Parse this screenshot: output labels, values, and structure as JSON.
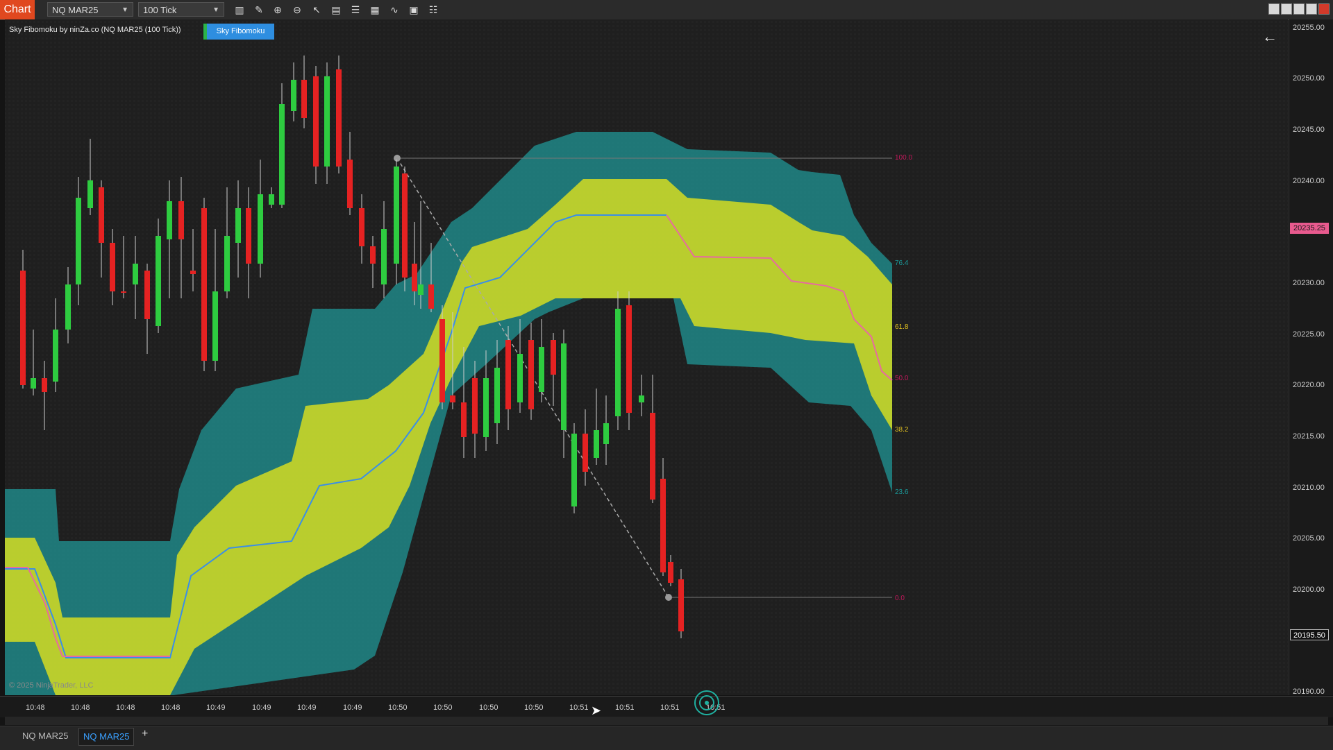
{
  "toolbar": {
    "chart_button": "Chart",
    "instrument": "NQ MAR25",
    "interval": "100 Tick",
    "icons": [
      "bars-icon",
      "draw-pencil-icon",
      "zoom-in-icon",
      "zoom-out-icon",
      "pointer-icon",
      "data-box-icon",
      "properties-icon",
      "strategy-icon",
      "indicators-icon",
      "list-icon"
    ]
  },
  "indicator": {
    "label": "Sky Fibomoku by ninZa.co (NQ MAR25 (100 Tick))",
    "button": "Sky Fibomoku"
  },
  "copyright": "© 2025 NinjaTrader, LLC",
  "price_axis": {
    "ticks": [
      "20255.00",
      "20250.00",
      "20245.00",
      "20240.00",
      "20235.00",
      "20230.00",
      "20225.00",
      "20220.00",
      "20215.00",
      "20210.00",
      "20205.00",
      "20200.00",
      "20195.00",
      "20190.00"
    ],
    "current_price": "20235.25",
    "last_price": "20195.50",
    "current_color": "#e85a8e"
  },
  "time_axis": {
    "ticks": [
      "10:48",
      "10:48",
      "10:48",
      "10:48",
      "10:49",
      "10:49",
      "10:49",
      "10:49",
      "10:50",
      "10:50",
      "10:50",
      "10:50",
      "10:51",
      "10:51",
      "10:51",
      "10:51"
    ]
  },
  "fib_levels": [
    {
      "label": "100.0",
      "color": "#c2185b"
    },
    {
      "label": "76.4",
      "color": "#1a9a9a"
    },
    {
      "label": "61.8",
      "color": "#e0c020"
    },
    {
      "label": "50.0",
      "color": "#c2185b"
    },
    {
      "label": "38.2",
      "color": "#e0c020"
    },
    {
      "label": "23.6",
      "color": "#1a9a9a"
    },
    {
      "label": "0.0",
      "color": "#c2185b"
    }
  ],
  "colors": {
    "bull": "#2ecc40",
    "bear": "#e52222",
    "cloud_teal": "#1f9c9c",
    "cloud_yellow": "#e6e61a",
    "midline_blue": "#3a8ee8",
    "midline_pink": "#e86aa0"
  },
  "tabs": [
    {
      "label": "NQ MAR25"
    },
    {
      "label": "NQ MAR25"
    }
  ],
  "add_tab": "+"
}
